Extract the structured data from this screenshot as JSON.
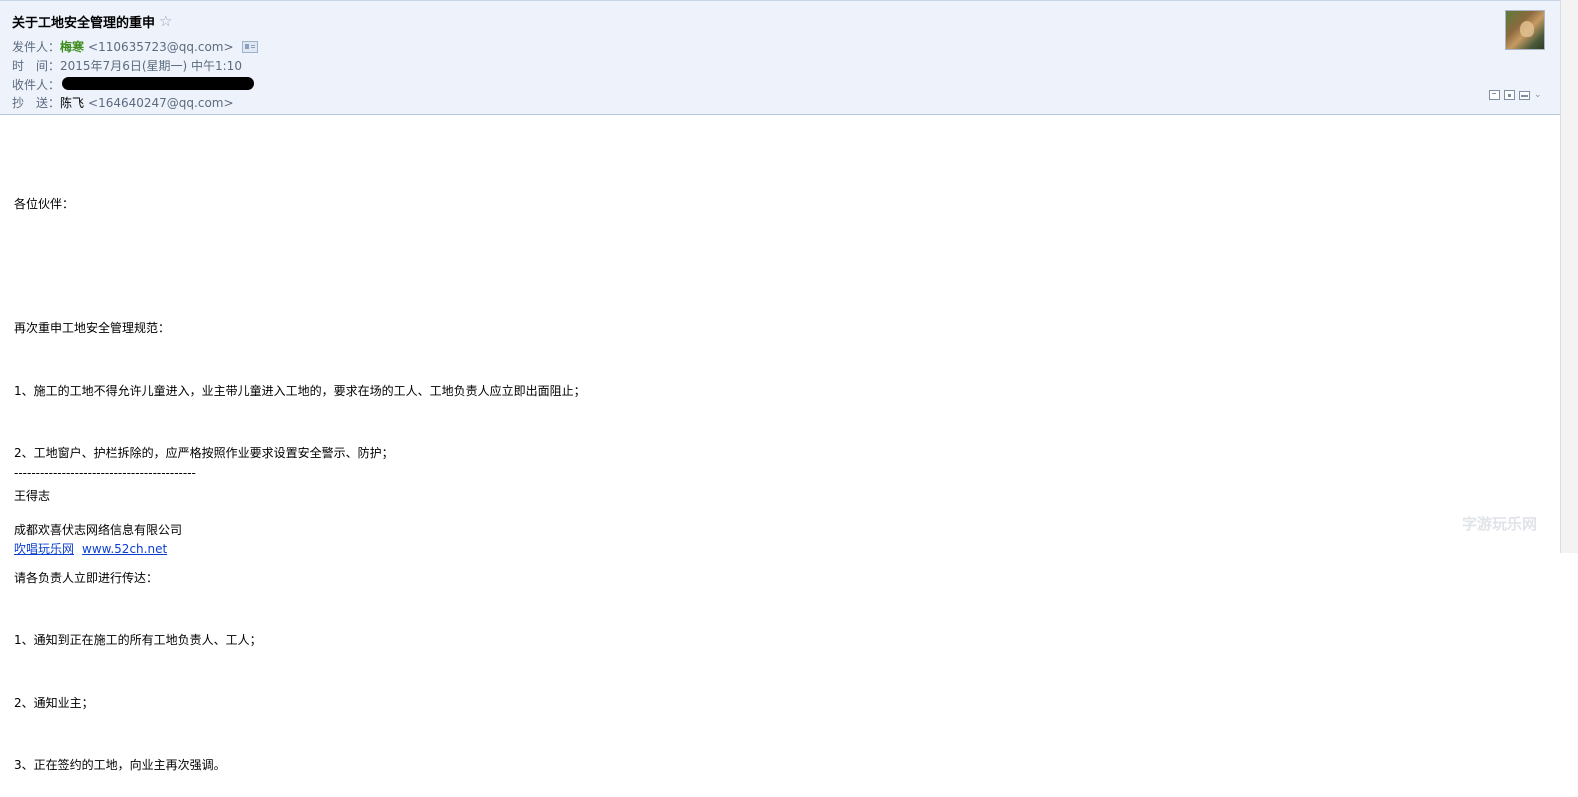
{
  "header": {
    "subject": "关于工地安全管理的重申",
    "star_icon": "☆",
    "from": {
      "label": "发件人：",
      "name": "梅寒",
      "address": "<110635723@qq.com>"
    },
    "time": {
      "label": "时　间：",
      "value": "2015年7月6日(星期一) 中午1:10"
    },
    "to": {
      "label": "收件人："
    },
    "cc": {
      "label": "抄　送：",
      "name": "陈飞",
      "address": "<164640247@qq.com>"
    }
  },
  "body": {
    "lines": [
      "各位伙伴：",
      "",
      "再次重申工地安全管理规范：",
      "1、施工的工地不得允许儿童进入，业主带儿童进入工地的，要求在场的工人、工地负责人应立即出面阻止；",
      "2、工地窗户、护栏拆除的，应严格按照作业要求设置安全警示、防护；",
      "",
      "请各负责人立即进行传达：",
      "1、通知到正在施工的所有工地负责人、工人；",
      "2、通知业主；",
      "3、正在签约的工地，向业主再次强调。"
    ]
  },
  "signature": {
    "separator": "------------------------------------------",
    "name": "王得志",
    "company": "成都欢喜伏志网络信息有限公司",
    "link_text": "吹唱玩乐网",
    "link_url_text": "www.52ch.net"
  },
  "watermark": "字游玩乐网"
}
